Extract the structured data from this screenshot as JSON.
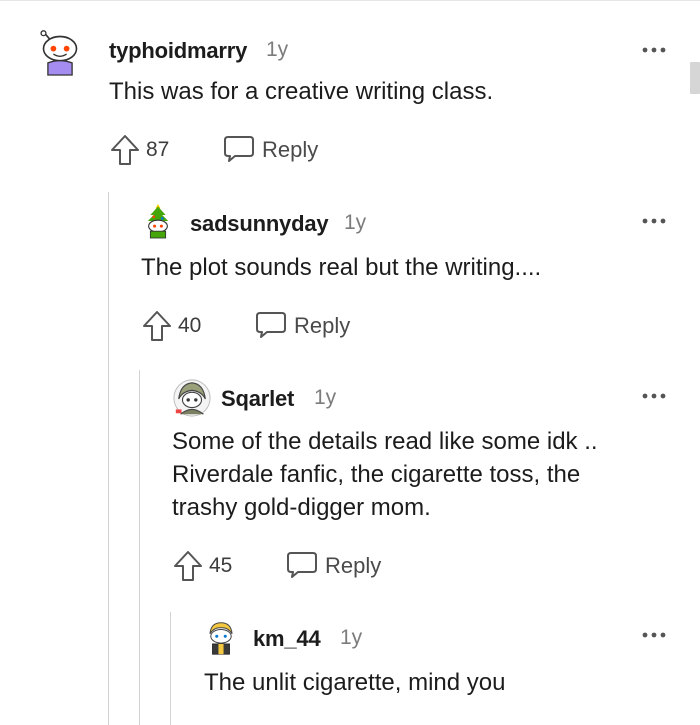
{
  "comments": [
    {
      "username": "typhoidmarry",
      "age": "1y",
      "text": "This was for a creative writing class.",
      "score": "87",
      "reply_label": "Reply",
      "avatar_icon": "snoo-avatar-purple-shirt",
      "more_icon": "more-options-icon"
    },
    {
      "username": "sadsunnyday",
      "age": "1y",
      "text": "The plot sounds real but the writing....",
      "score": "40",
      "reply_label": "Reply",
      "avatar_icon": "snoo-avatar-christmas-tree",
      "more_icon": "more-options-icon"
    },
    {
      "username": "Sqarlet",
      "age": "1y",
      "text": "Some of the details read like some idk ..\nRiverdale fanfic, the cigarette toss, the\ntrashy gold-digger mom.",
      "score": "45",
      "reply_label": "Reply",
      "avatar_icon": "snoo-avatar-grey-hood",
      "more_icon": "more-options-icon"
    },
    {
      "username": "km_44",
      "age": "1y",
      "text": "The unlit cigarette, mind you",
      "avatar_icon": "snoo-avatar-blonde",
      "more_icon": "more-options-icon"
    }
  ],
  "colors": {
    "text": "#1c1c1c",
    "meta": "#7c7c7c",
    "thread_line": "#d3d3d3",
    "icon": "#555555"
  }
}
